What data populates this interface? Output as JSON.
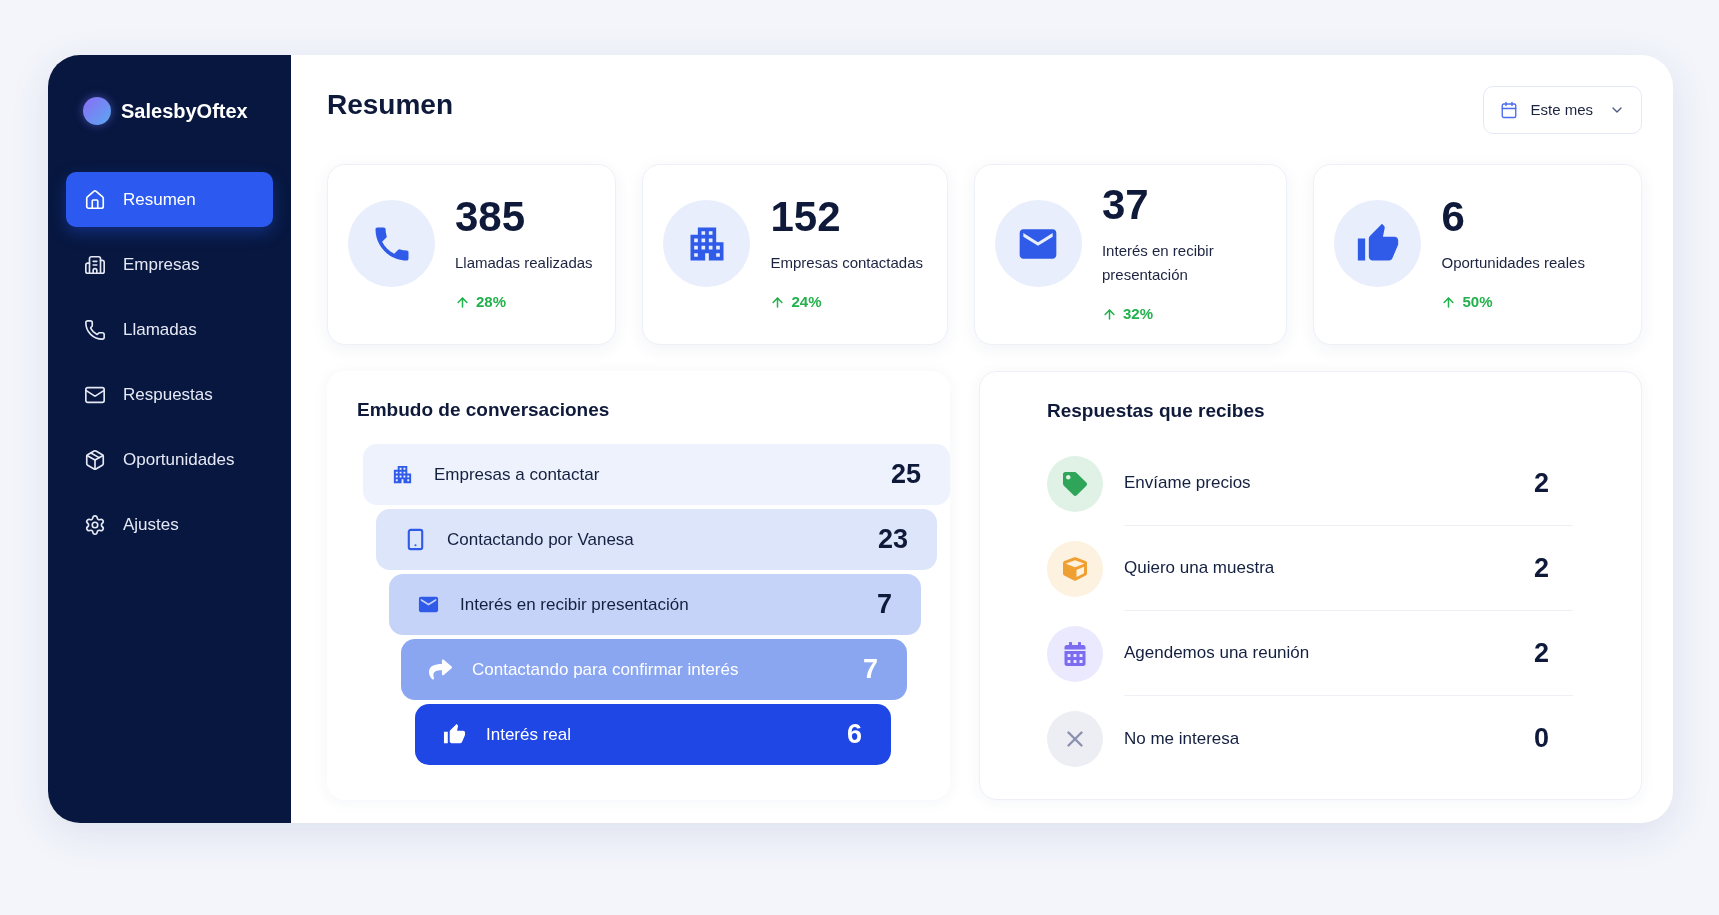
{
  "sidebar": {
    "brand": "SalesbyOftex",
    "items": [
      {
        "label": "Resumen",
        "selected": true
      },
      {
        "label": "Empresas",
        "selected": false
      },
      {
        "label": "Llamadas",
        "selected": false
      },
      {
        "label": "Respuestas",
        "selected": false
      },
      {
        "label": "Oportunidades",
        "selected": false
      },
      {
        "label": "Ajustes",
        "selected": false
      }
    ]
  },
  "header": {
    "title": "Resumen",
    "period_button": {
      "label": "Este mes"
    }
  },
  "stats": [
    {
      "value": "385",
      "label": "Llamadas realizadas",
      "change": "28%"
    },
    {
      "value": "152",
      "label": "Empresas contactadas",
      "change": "24%"
    },
    {
      "value": "37",
      "label": "Interés en recibir presentación",
      "change": "32%"
    },
    {
      "value": "6",
      "label": "Oportunidades reales",
      "change": "50%"
    }
  ],
  "funnel": {
    "title": "Embudo de conversaciones",
    "stages": [
      {
        "label": "Empresas a contactar",
        "count": "25",
        "color": "#eef2fd"
      },
      {
        "label": "Contactando por Vanesa",
        "count": "23",
        "color": "#dde5fb"
      },
      {
        "label": "Interés en recibir presentación",
        "count": "7",
        "color": "#c6d3f8"
      },
      {
        "label": "Contactando para confirmar interés",
        "count": "7",
        "color": "#8ba6f1"
      },
      {
        "label": "Interés real",
        "count": "6",
        "color": "#1f47e6"
      }
    ]
  },
  "responses": {
    "title": "Respuestas que recibes",
    "items": [
      {
        "label": "Envíame precios",
        "count": "2",
        "color": "#2fa55a"
      },
      {
        "label": "Quiero una muestra",
        "count": "2",
        "color": "#f0a033"
      },
      {
        "label": "Agendemos una reunión",
        "count": "2",
        "color": "#7b6cf0"
      },
      {
        "label": "No me interesa",
        "count": "0",
        "color": "#8a90ae"
      }
    ]
  }
}
